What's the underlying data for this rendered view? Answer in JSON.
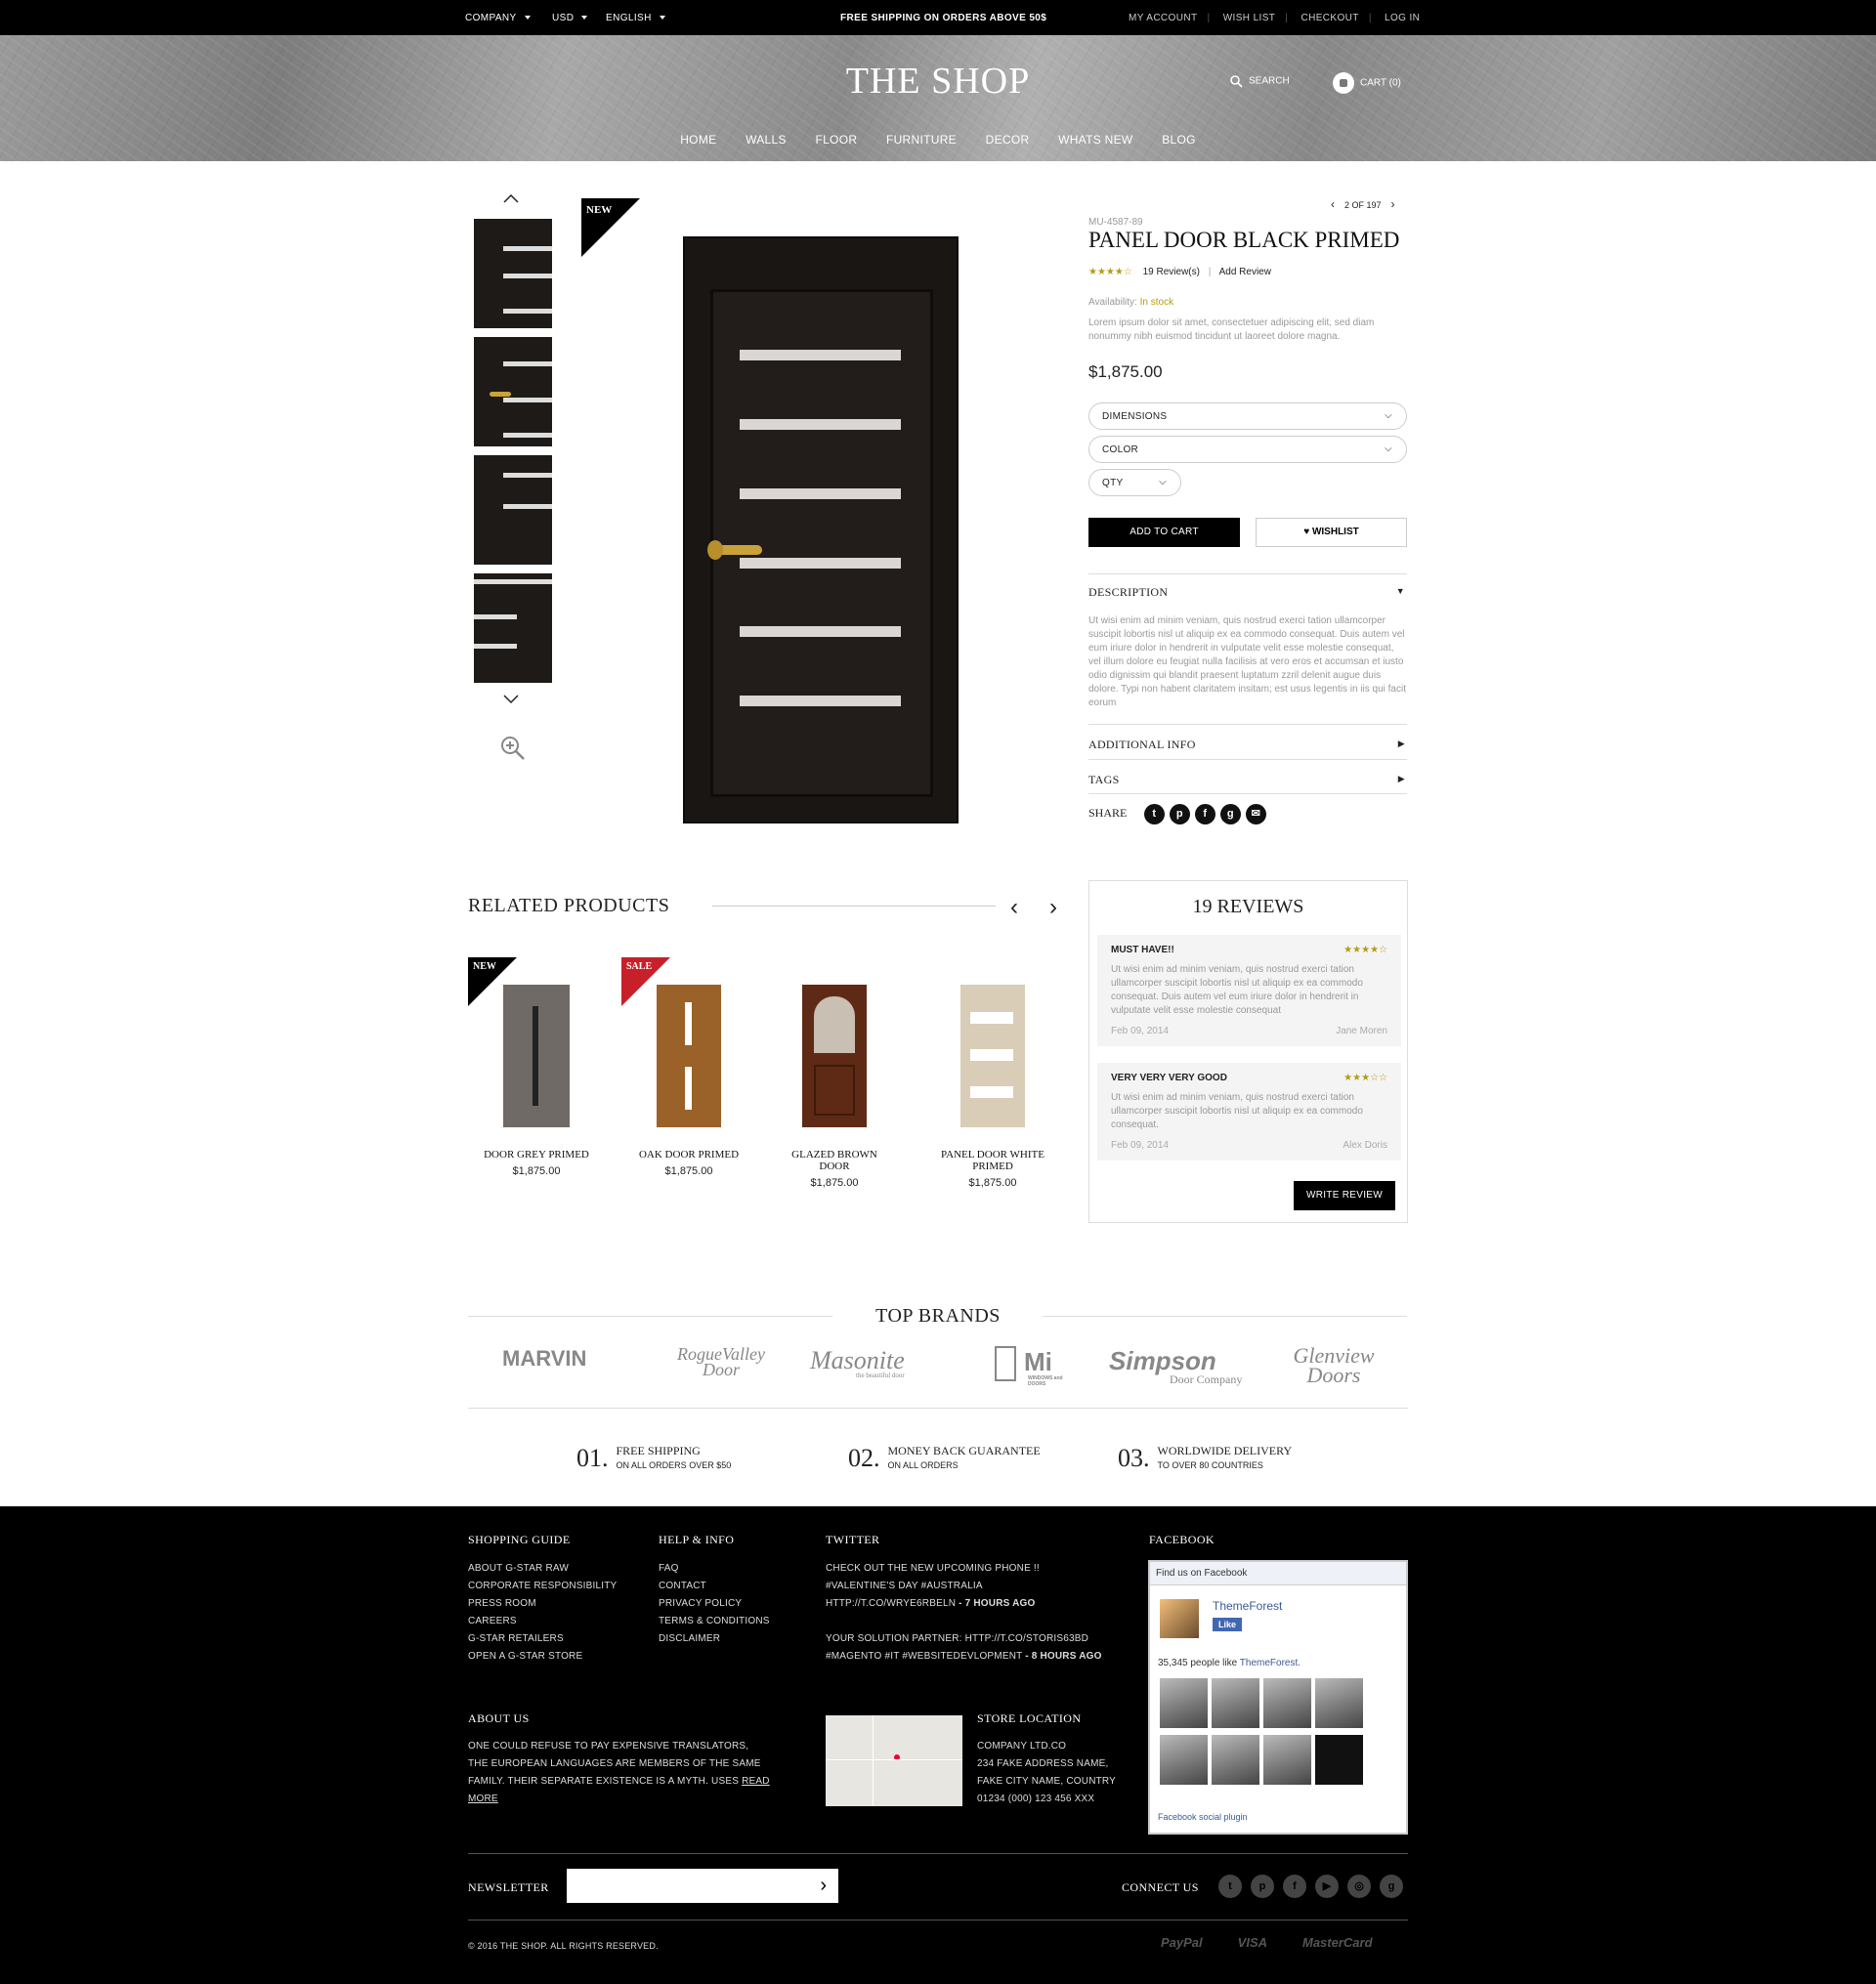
{
  "topbar": {
    "company": "COMPANY",
    "currency": "USD",
    "language": "ENGLISH",
    "promo": "FREE SHIPPING ON ORDERS ABOVE 50$",
    "my_account": "MY ACCOUNT",
    "wish_list": "WISH LIST",
    "checkout": "CHECKOUT",
    "login": "LOG IN"
  },
  "header": {
    "logo": "THE SHOP",
    "search": "SEARCH",
    "cart": "CART (0)"
  },
  "nav": [
    "HOME",
    "WALLS",
    "FLOOR",
    "FURNITURE",
    "DECOR",
    "WHATS NEW",
    "BLOG"
  ],
  "gallery": {
    "badge": "NEW"
  },
  "product": {
    "pager": "2 OF 197",
    "sku": "MU-4587-89",
    "title": "PANEL DOOR BLACK PRIMED",
    "rating": 4,
    "reviews": "19 Review(s)",
    "add_review": "Add Review",
    "availability_label": "Availability:",
    "availability": "In stock",
    "short_desc": "Lorem ipsum dolor sit amet, consectetuer adipiscing elit, sed diam nonummy nibh euismod tincidunt ut laoreet dolore magna.",
    "price": "$1,875.00",
    "dimensions": "DIMENSIONS",
    "color": "COLOR",
    "qty": "QTY",
    "add_to_cart": "ADD TO CART",
    "wishlist": "WISHLIST",
    "description_title": "DESCRIPTION",
    "description": "Ut wisi enim ad minim veniam, quis nostrud exerci tation ullamcorper suscipit lobortis nisl ut aliquip ex ea commodo consequat. Duis autem vel eum iriure dolor in hendrerit in vulputate velit esse molestie consequat, vel illum dolore eu feugiat nulla facilisis at vero eros et accumsan et iusto odio dignissim qui blandit praesent luptatum zzril delenit augue duis dolore. Typi non habent claritatem insitam; est usus legentis in iis qui facit eorum",
    "additional_info": "ADDITIONAL INFO",
    "tags": "TAGS",
    "share": "SHARE"
  },
  "related": {
    "title": "RELATED PRODUCTS",
    "items": [
      {
        "badge": "NEW",
        "name": "DOOR GREY PRIMED",
        "price": "$1,875.00",
        "color": "#6f6a66"
      },
      {
        "badge": "SALE",
        "name": "OAK DOOR PRIMED",
        "price": "$1,875.00",
        "color": "#9a6128"
      },
      {
        "badge": "",
        "name": "GLAZED BROWN DOOR",
        "price": "$1,875.00",
        "color": "#5e2a16"
      },
      {
        "badge": "",
        "name": "PANEL DOOR WHITE PRIMED",
        "price": "$1,875.00",
        "color": "#d9cdb8"
      }
    ]
  },
  "reviews": {
    "title": "19 REVIEWS",
    "items": [
      {
        "title": "MUST HAVE!!",
        "stars": 4,
        "text": "Ut wisi enim ad minim veniam, quis nostrud exerci tation ullamcorper suscipit lobortis nisl ut aliquip ex ea commodo consequat. Duis autem vel eum iriure dolor in hendrerit in vulputate velit esse molestie consequat",
        "date": "Feb 09, 2014",
        "author": "Jane Moren"
      },
      {
        "title": "VERY VERY VERY GOOD",
        "stars": 3,
        "text": "Ut wisi enim ad minim veniam, quis nostrud exerci tation ullamcorper suscipit lobortis nisl ut aliquip ex ea commodo consequat.",
        "date": "Feb 09, 2014",
        "author": "Alex Doris"
      }
    ],
    "write": "WRITE REVIEW"
  },
  "brands": {
    "title": "TOP BRANDS",
    "items": [
      "MARVIN",
      "RogueValley Door",
      "Masonite",
      "Mi",
      "Simpson",
      "Glenview Doors"
    ],
    "sub": {
      "mi": "WINDOWS and DOORS",
      "simpson": "Door Company",
      "masonite": "the beautiful door"
    }
  },
  "features": [
    {
      "num": "01.",
      "title": "FREE SHIPPING",
      "sub": "ON ALL ORDERS OVER $50"
    },
    {
      "num": "02.",
      "title": "MONEY BACK GUARANTEE",
      "sub": "ON ALL ORDERS"
    },
    {
      "num": "03.",
      "title": "WORLDWIDE DELIVERY",
      "sub": "TO OVER 80 COUNTRIES"
    }
  ],
  "footer": {
    "shopping_title": "SHOPPING GUIDE",
    "shopping": [
      "ABOUT G-STAR RAW",
      "CORPORATE RESPONSIBILITY",
      "PRESS ROOM",
      "CAREERS",
      "G-STAR RETAILERS",
      "OPEN A G-STAR STORE"
    ],
    "help_title": "HELP & INFO",
    "help": [
      "FAQ",
      "CONTACT",
      "PRIVACY POLICY",
      "TERMS & CONDITIONS",
      "DISCLAIMER"
    ],
    "twitter_title": "TWITTER",
    "tweet1": "CHECK OUT THE NEW UPCOMING PHONE !! #VALENTINE'S DAY #AUSTRALIA HTTP://T.CO/WRYE6RBELN",
    "tweet1_time": "- 7 HOURS AGO",
    "tweet2": "YOUR SOLUTION PARTNER: HTTP://T.CO/STORIS63BD #MAGENTO #IT #WEBSITEDEVLOPMENT",
    "tweet2_time": "- 8 HOURS AGO",
    "facebook_title": "FACEBOOK",
    "fb_find": "Find us on Facebook",
    "fb_page": "ThemeForest",
    "fb_like": "Like",
    "fb_count": "35,345 people like",
    "fb_count_link": "ThemeForest.",
    "fb_plugin": "Facebook social plugin",
    "about_title": "ABOUT US",
    "about": "ONE COULD REFUSE TO PAY EXPENSIVE TRANSLATORS, THE EUROPEAN LANGUAGES ARE MEMBERS OF THE SAME FAMILY. THEIR SEPARATE EXISTENCE IS A MYTH. USES",
    "read_more": "READ MORE",
    "store_title": "STORE LOCATION",
    "store": [
      "COMPANY LTD.CO",
      "234 FAKE ADDRESS NAME,",
      "FAKE CITY NAME, COUNTRY",
      "01234 (000) 123 456 XXX"
    ],
    "newsletter": "NEWSLETTER",
    "connect": "CONNECT US",
    "copyright": "© 2016 THE SHOP. ALL RIGHTS RESERVED.",
    "payments": [
      "PayPal",
      "VISA",
      "MasterCard"
    ]
  }
}
